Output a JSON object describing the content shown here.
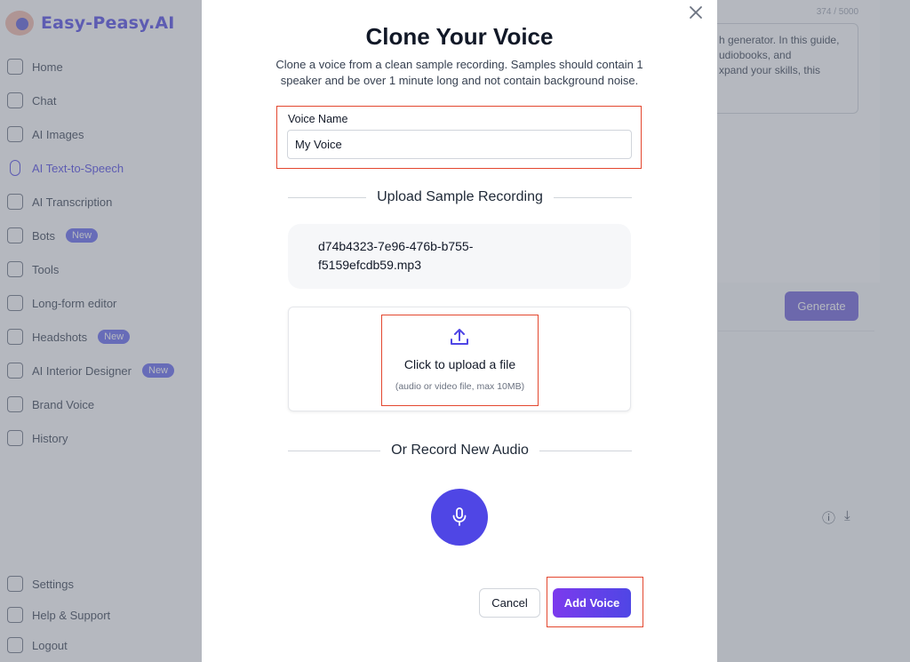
{
  "background": {
    "logo_text": "Easy-Peasy.AI",
    "nav": [
      {
        "label": "Home",
        "icon": "home-icon"
      },
      {
        "label": "Chat",
        "icon": "chat-icon"
      },
      {
        "label": "AI Images",
        "icon": "image-icon"
      },
      {
        "label": "AI Text-to-Speech",
        "icon": "microphone-icon",
        "active": true
      },
      {
        "label": "AI Transcription",
        "icon": "waveform-icon"
      },
      {
        "label": "Bots",
        "icon": "robot-icon",
        "badge": "New"
      },
      {
        "label": "Tools",
        "icon": "toolbox-icon"
      },
      {
        "label": "Long-form editor",
        "icon": "document-icon"
      },
      {
        "label": "Headshots",
        "icon": "camera-icon",
        "badge": "New"
      },
      {
        "label": "AI Interior Designer",
        "icon": "sofa-icon",
        "badge": "New"
      },
      {
        "label": "Brand Voice",
        "icon": "megaphone-icon"
      },
      {
        "label": "History",
        "icon": "history-icon"
      }
    ],
    "footer_nav": [
      {
        "label": "Settings",
        "icon": "gear-icon"
      },
      {
        "label": "Help & Support",
        "icon": "help-icon"
      },
      {
        "label": "Logout",
        "icon": "logout-icon"
      }
    ],
    "char_counter": "374 / 5000",
    "textarea_lines": [
      "h generator. In this guide,",
      "udiobooks, and",
      "xpand your skills, this"
    ],
    "generate_label": "Generate"
  },
  "modal": {
    "title": "Clone Your Voice",
    "subtitle": "Clone a voice from a clean sample recording. Samples should contain 1 speaker and be over 1 minute long and not contain background noise.",
    "voice_name_label": "Voice Name",
    "voice_name_value": "My Voice",
    "upload_section_title": "Upload Sample Recording",
    "uploaded_file_line1": "d74b4323-7e96-476b-b755-",
    "uploaded_file_line2": "f5159efcdb59.mp3",
    "upload_title": "Click to upload a file",
    "upload_hint": "(audio or video file, max 10MB)",
    "record_section_title": "Or Record New Audio",
    "cancel_label": "Cancel",
    "add_voice_label": "Add Voice"
  },
  "colors": {
    "accent": "#4f46e5",
    "highlight_border": "#e3472f"
  }
}
